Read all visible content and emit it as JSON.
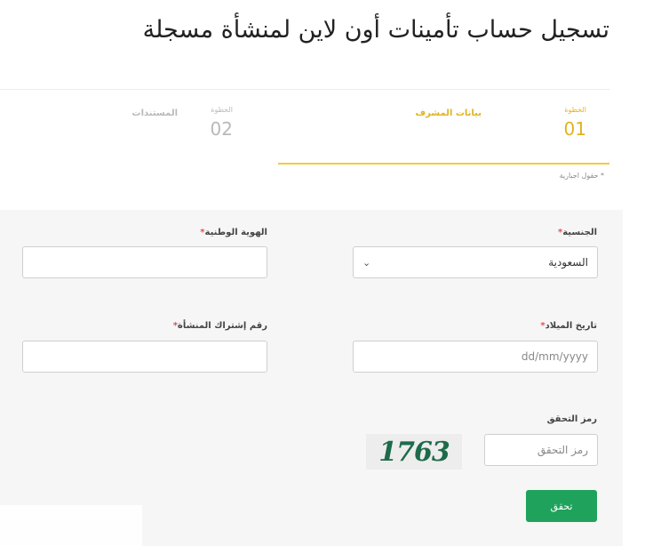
{
  "page": {
    "title": "تسجيل حساب تأمينات أون لاين لمنشأة مسجلة"
  },
  "stepper": {
    "steps": [
      {
        "small_label": "الخطوة",
        "number": "01",
        "title": "بيانات المشرف",
        "active": true
      },
      {
        "small_label": "الخطوة",
        "number": "02",
        "title": "المستندات",
        "active": false
      }
    ],
    "accent_color": "#f2cc3c"
  },
  "form": {
    "required_note": "* حقول اجبارية",
    "nationality": {
      "label": "الجنسية",
      "value": "السعودية"
    },
    "national_id": {
      "label": "الهوية الوطنية",
      "value": ""
    },
    "birth_date": {
      "label": "تاريخ الميلاد",
      "placeholder": "dd/mm/yyyy"
    },
    "subscription_number": {
      "label": "رقم إشتراك المنشأة",
      "value": ""
    },
    "captcha": {
      "label": "رمز التحقق",
      "placeholder": "رمز التحقق",
      "image_text": "1763"
    },
    "verify_button": "تحقق",
    "required_mark": "*"
  },
  "colors": {
    "primary_button": "#1fa35c",
    "active_step": "#e0b41f",
    "inactive_step": "#b9b9b9",
    "required": "#e05252"
  }
}
